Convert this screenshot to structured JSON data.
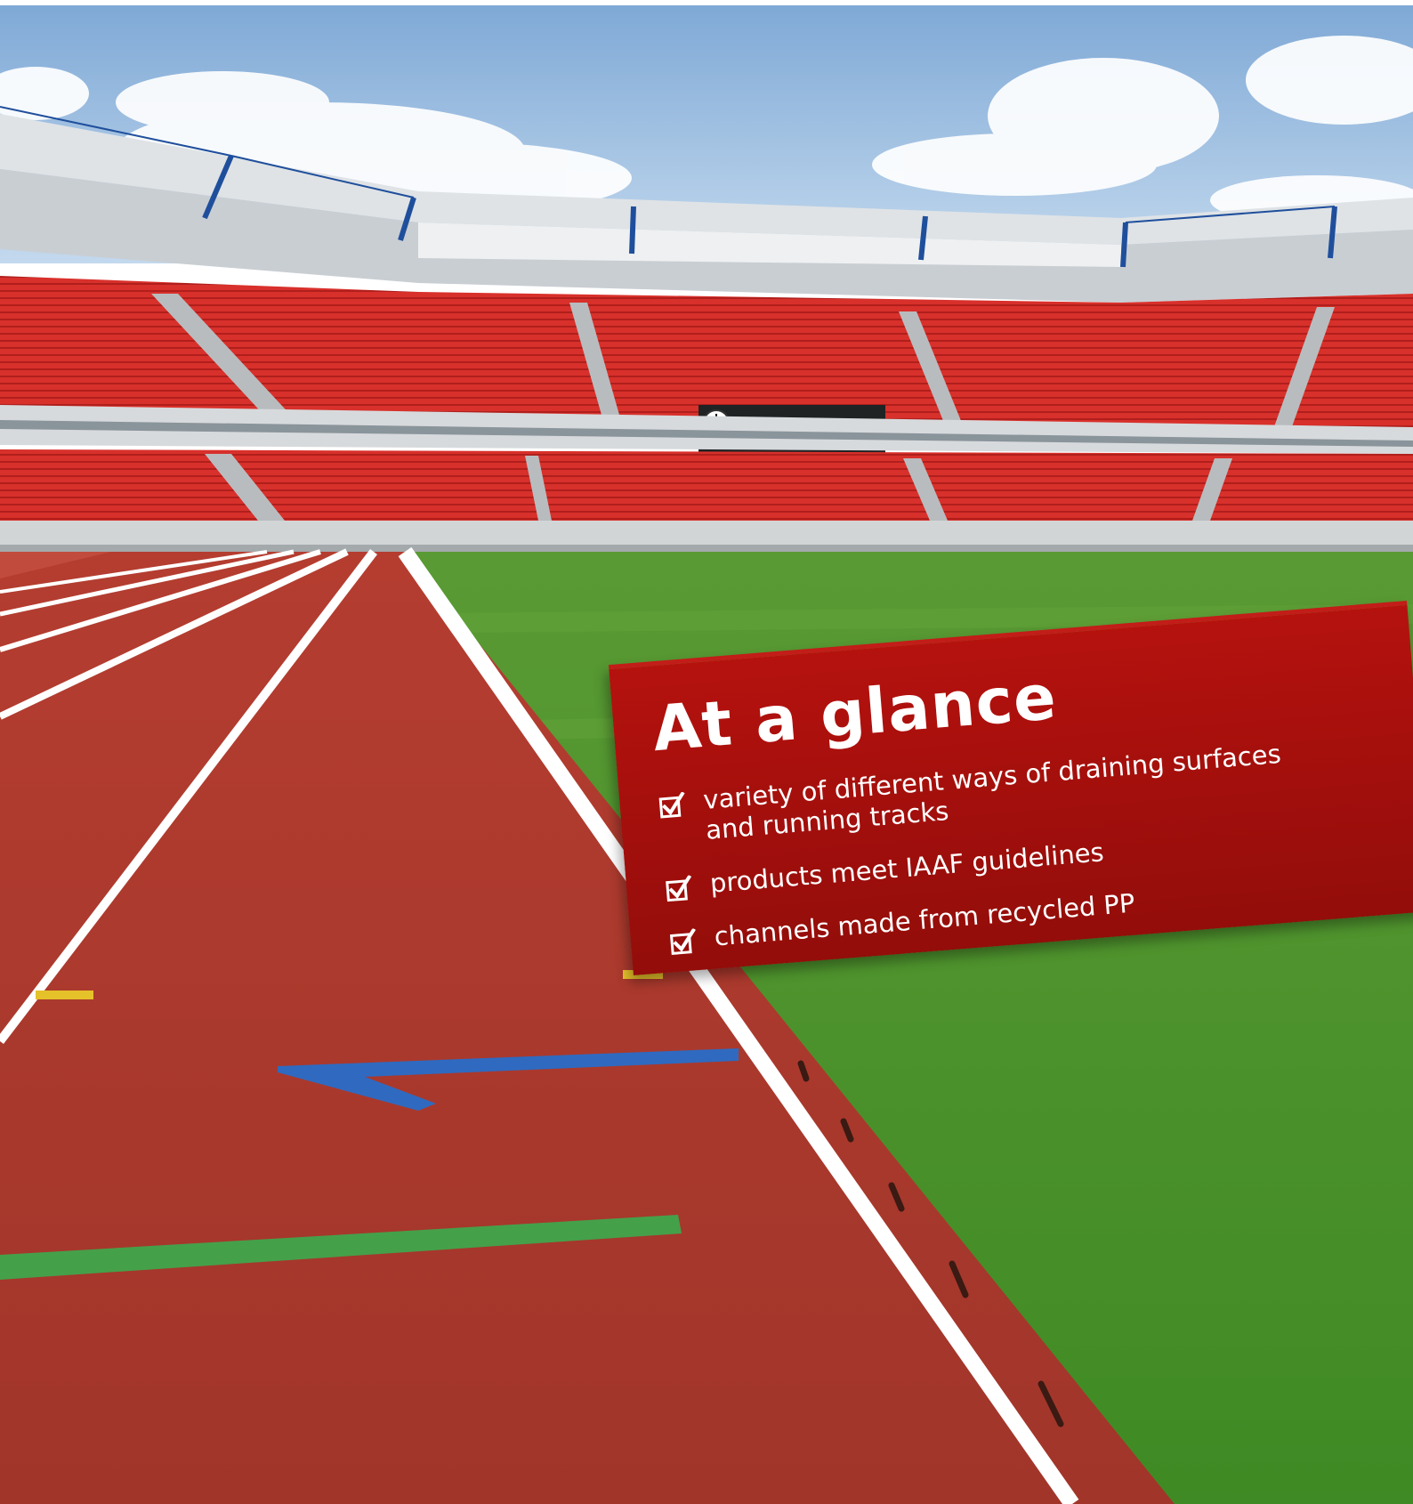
{
  "banner": {
    "title": "At a glance",
    "items": [
      {
        "lines": [
          "variety of different ways of draining surfaces",
          "and running tracks"
        ]
      },
      {
        "lines": [
          "products meet IAAF guidelines"
        ]
      },
      {
        "lines": [
          "channels made from recycled PP"
        ]
      }
    ],
    "icon": "checkbox-checked-icon"
  },
  "colors": {
    "banner": "#a20f0c",
    "track": "#a8352b",
    "grass": "#4f9a2c",
    "seats": "#d42a26",
    "sky": "#8fb6dc"
  }
}
